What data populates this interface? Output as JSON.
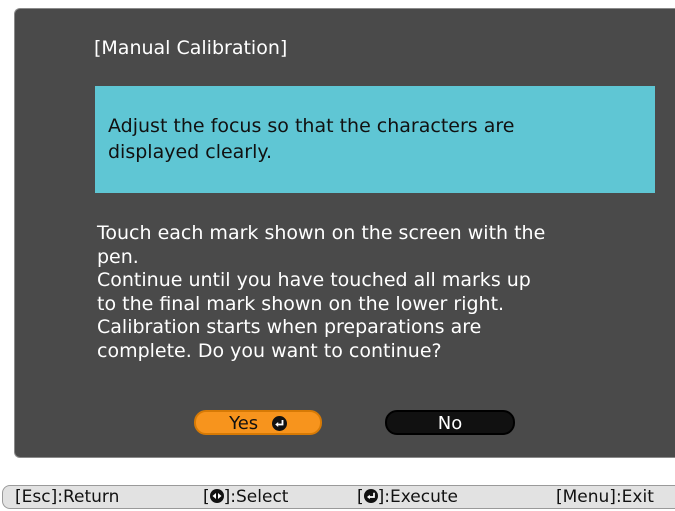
{
  "dialog": {
    "title": "[Manual Calibration]",
    "notice_lines": [
      "Adjust the focus so that the characters are",
      "displayed clearly."
    ],
    "message_lines": [
      "Touch each mark shown on the screen with the",
      "pen.",
      "Continue until you have touched all marks up",
      "to the final mark shown on the lower right.",
      "Calibration starts when preparations are",
      "complete. Do you want to continue?"
    ],
    "buttons": {
      "yes_label": "Yes",
      "no_label": "No",
      "selected": "yes"
    }
  },
  "footer": {
    "esc_key": "[Esc]",
    "esc_action": ":Return",
    "select_key_open": "[",
    "select_key_close": "]",
    "select_action": ":Select",
    "execute_key_open": "[",
    "execute_key_close": "]",
    "execute_action": ":Execute",
    "menu_key": "[Menu]",
    "menu_action": ":Exit"
  },
  "icons": {
    "select": "left-right-arrows-icon",
    "execute": "enter-icon"
  },
  "colors": {
    "dialog_bg": "#4a4a4a",
    "notice_bg": "#5fc6d4",
    "yes_button": "#f7941d",
    "no_button": "#111111",
    "footer_bg": "#e2e2e2"
  }
}
